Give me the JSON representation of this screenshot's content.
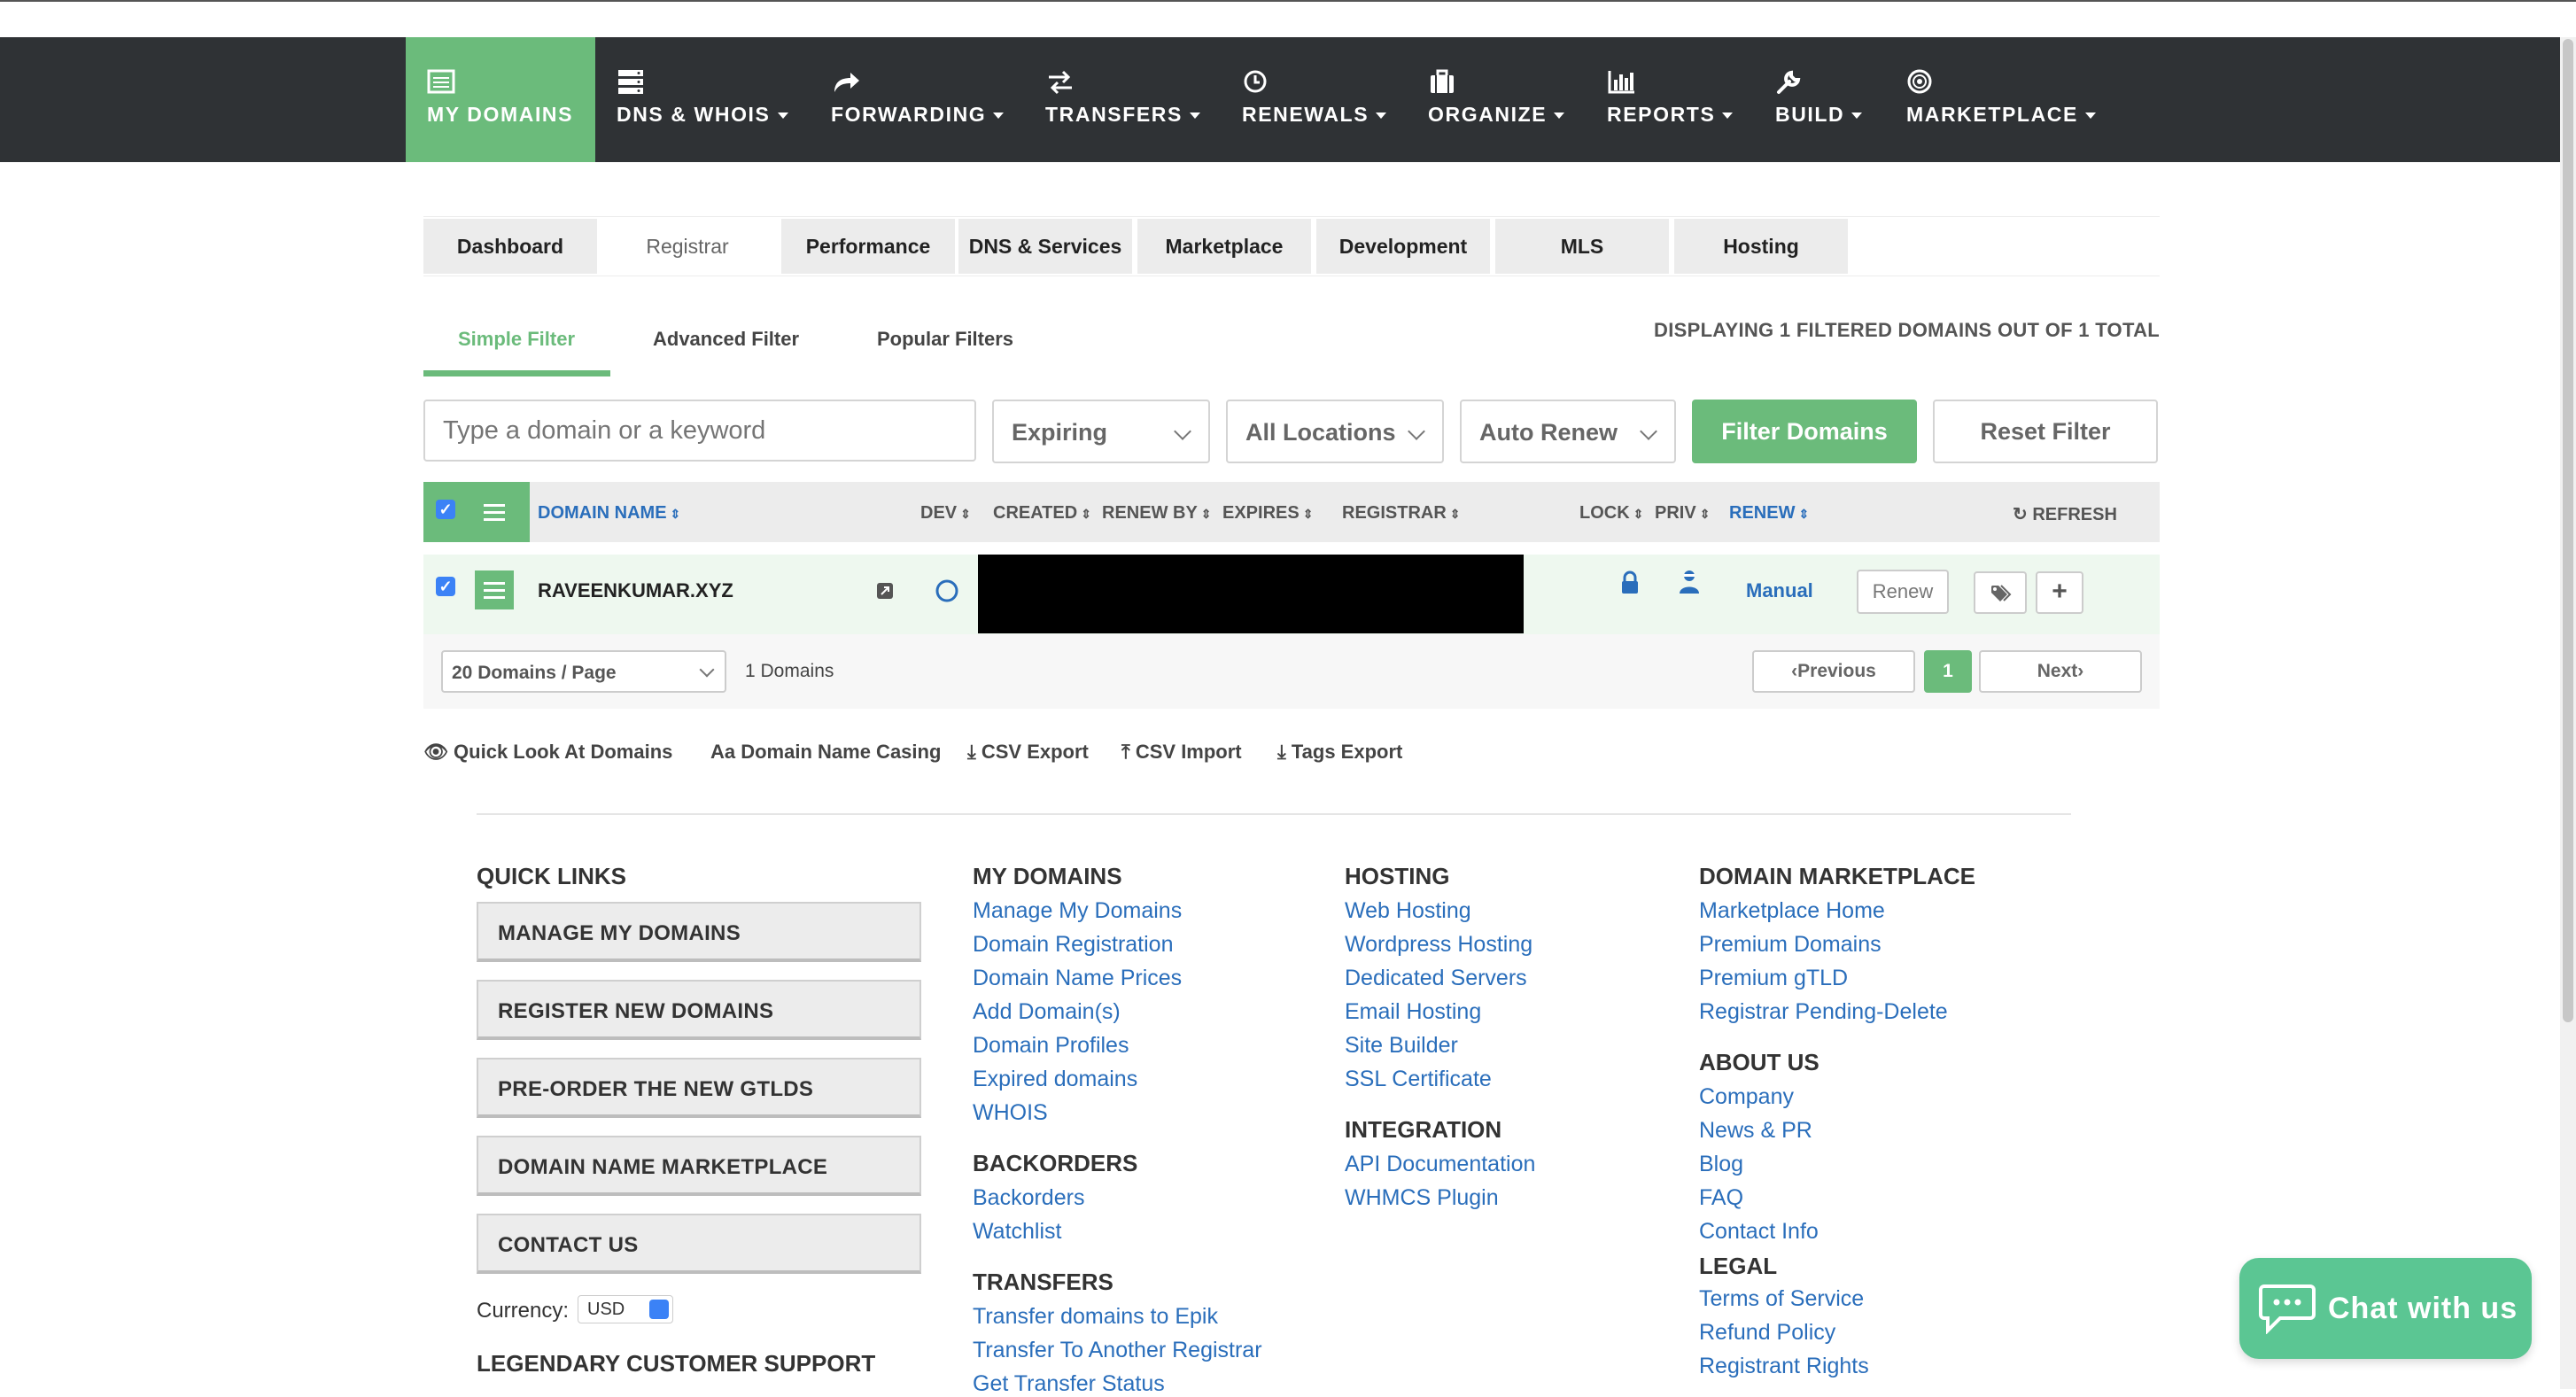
{
  "nav": {
    "items": [
      {
        "label": "MY DOMAINS",
        "icon": "list-icon",
        "active": true,
        "caret": false
      },
      {
        "label": "DNS & WHOIS",
        "icon": "server-icon",
        "active": false,
        "caret": true
      },
      {
        "label": "FORWARDING",
        "icon": "share-arrow-icon",
        "active": false,
        "caret": true
      },
      {
        "label": "TRANSFERS",
        "icon": "exchange-icon",
        "active": false,
        "caret": true
      },
      {
        "label": "RENEWALS",
        "icon": "clock-icon",
        "active": false,
        "caret": true
      },
      {
        "label": "ORGANIZE",
        "icon": "briefcase-icon",
        "active": false,
        "caret": true
      },
      {
        "label": "REPORTS",
        "icon": "bar-chart-icon",
        "active": false,
        "caret": true
      },
      {
        "label": "BUILD",
        "icon": "wrench-icon",
        "active": false,
        "caret": true
      },
      {
        "label": "MARKETPLACE",
        "icon": "target-icon",
        "active": false,
        "caret": true
      }
    ]
  },
  "tabs": [
    "Dashboard",
    "Registrar",
    "Performance",
    "DNS & Services",
    "Marketplace",
    "Development",
    "MLS",
    "Hosting"
  ],
  "active_tab": "Registrar",
  "filter_tabs": [
    "Simple Filter",
    "Advanced Filter",
    "Popular Filters"
  ],
  "active_filter_tab": "Simple Filter",
  "display_count": "DISPLAYING 1 FILTERED DOMAINS OUT OF 1 TOTAL",
  "filters": {
    "search_placeholder": "Type a domain or a keyword",
    "expiry_select": "Expiring",
    "location_select": "All Locations",
    "autorenew_select": "Auto Renew",
    "filter_button": "Filter Domains",
    "reset_button": "Reset Filter"
  },
  "table": {
    "headers": {
      "domain_name": "DOMAIN NAME",
      "dev": "DEV",
      "created": "CREATED",
      "renew_by": "RENEW BY",
      "expires": "EXPIRES",
      "registrar": "REGISTRAR",
      "lock": "LOCK",
      "priv": "PRIV",
      "renew": "RENEW",
      "refresh": "REFRESH"
    },
    "rows": [
      {
        "domain": "RAVEENKUMAR.XYZ",
        "renew_mode": "Manual",
        "renew_button": "Renew",
        "checked": true
      }
    ],
    "per_page": "20 Domains / Page",
    "domain_count": "1 Domains",
    "pagination": {
      "previous": "Previous",
      "current": "1",
      "next": "Next"
    }
  },
  "tools": [
    "Quick Look At Domains",
    "Aa Domain Name Casing",
    "CSV Export",
    "CSV Import",
    "Tags Export"
  ],
  "footer": {
    "quick_links": {
      "title": "QUICK LINKS",
      "buttons": [
        "MANAGE MY DOMAINS",
        "REGISTER NEW DOMAINS",
        "PRE-ORDER THE NEW GTLDS",
        "DOMAIN NAME MARKETPLACE",
        "CONTACT US"
      ]
    },
    "currency_label": "Currency:",
    "currency_value": "USD",
    "support_title": "LEGENDARY CUSTOMER SUPPORT",
    "my_domains": {
      "title": "MY DOMAINS",
      "links": [
        "Manage My Domains",
        "Domain Registration",
        "Domain Name Prices",
        "Add Domain(s)",
        "Domain Profiles",
        "Expired domains",
        "WHOIS"
      ]
    },
    "backorders": {
      "title": "BACKORDERS",
      "links": [
        "Backorders",
        "Watchlist"
      ]
    },
    "transfers": {
      "title": "TRANSFERS",
      "links": [
        "Transfer domains to Epik",
        "Transfer To Another Registrar",
        "Get Transfer Status"
      ]
    },
    "hosting": {
      "title": "HOSTING",
      "links": [
        "Web Hosting",
        "Wordpress Hosting",
        "Dedicated Servers",
        "Email Hosting",
        "Site Builder",
        "SSL Certificate"
      ]
    },
    "integration": {
      "title": "INTEGRATION",
      "links": [
        "API Documentation",
        "WHMCS Plugin"
      ]
    },
    "domain_marketplace": {
      "title": "DOMAIN MARKETPLACE",
      "links": [
        "Marketplace Home",
        "Premium Domains",
        "Premium gTLD",
        "Registrar Pending-Delete"
      ]
    },
    "about_us": {
      "title": "ABOUT US",
      "links": [
        "Company",
        "News & PR",
        "Blog",
        "FAQ",
        "Contact Info"
      ]
    },
    "legal": {
      "title": "LEGAL",
      "links": [
        "Terms of Service",
        "Refund Policy",
        "Registrant Rights"
      ]
    }
  },
  "chat": {
    "label": "Chat with us"
  },
  "colors": {
    "nav_bg": "#2f3235",
    "accent_green": "#6bbb7b",
    "link_blue": "#2a6ebb",
    "chat_green": "#5bc693"
  }
}
